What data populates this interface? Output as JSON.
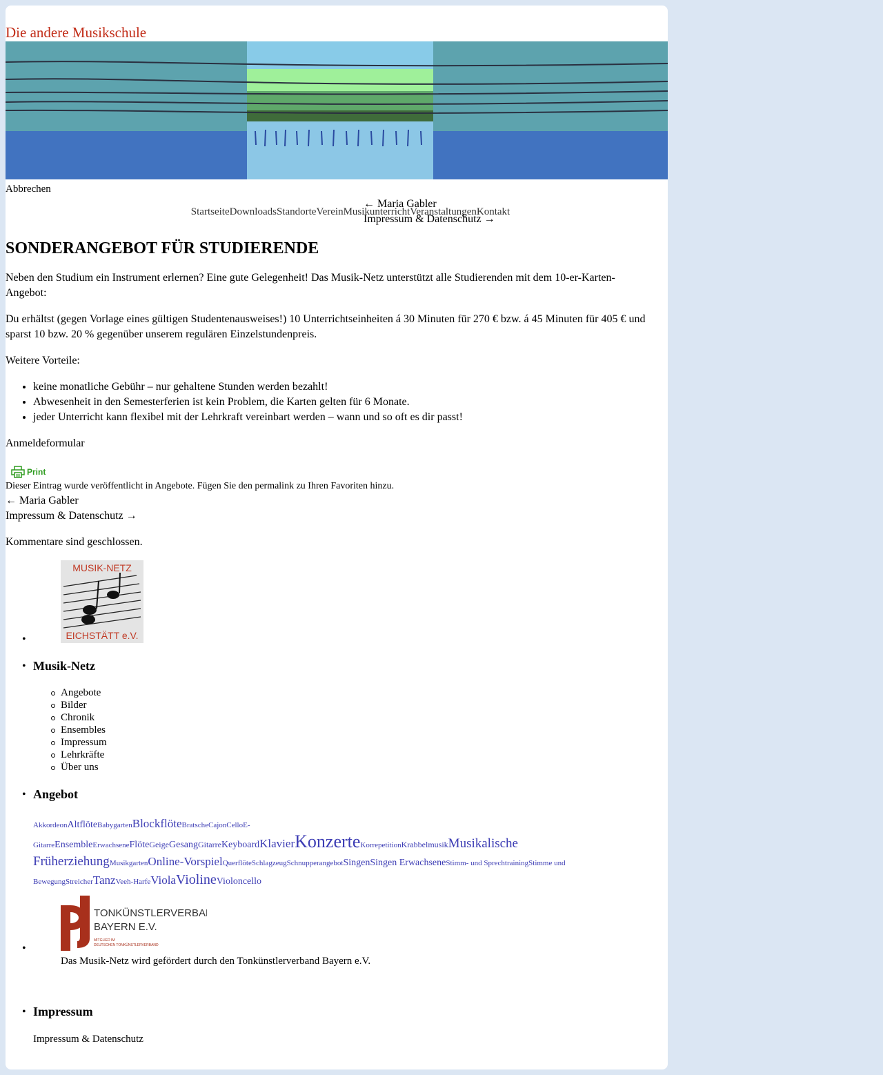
{
  "site": {
    "title": "Die andere Musikschule"
  },
  "abort_label": "Abbrechen",
  "post_nav": {
    "prev": "← Maria Gabler",
    "next": "Impressum & Datenschutz →"
  },
  "menu": [
    "Startseite",
    "Downloads",
    "Standorte",
    "Verein",
    "Musikunterricht",
    "Veranstaltungen",
    "Kontakt"
  ],
  "post": {
    "title": "SONDERANGEBOT FÜR STUDIERENDE",
    "p1": "Neben den Studium ein Instrument erlernen? Eine gute Gelegenheit! Das Musik-Netz unterstützt alle Studierenden mit dem 10-er-Karten-Angebot:",
    "p2": "Du erhältst (gegen Vorlage eines gültigen Studentenausweises!) 10 Unterrichtseinheiten á 30 Minuten für 270 € bzw. á 45 Minuten für 405 € und sparst 10 bzw. 20 % gegenüber unserem regulären Einzelstundenpreis.",
    "p3": "Weitere Vorteile:",
    "advantages": [
      "keine monatliche Gebühr – nur gehaltene Stunden werden bezahlt!",
      "Abwesenheit in den Semesterferien ist kein Problem, die Karten gelten für 6 Monate.",
      "jeder Unterricht kann flexibel mit der Lehrkraft vereinbart werden – wann und so oft es dir passt!"
    ],
    "form_link": "Anmeldeformular",
    "print_label": "Print",
    "meta": "Dieser Eintrag wurde veröffentlicht in Angebote. Fügen Sie den permalink zu Ihren Favoriten hinzu.",
    "comments_closed": "Kommentare sind geschlossen."
  },
  "sidebar": {
    "logo_musiknetz": {
      "line1": "MUSIK-NETZ",
      "line2": "EICHSTÄTT e.V."
    },
    "musiknetz_title": "Musik-Netz",
    "musiknetz_items": [
      "Angebote",
      "Bilder",
      "Chronik",
      "Ensembles",
      "Impressum",
      "Lehrkräfte",
      "Über uns"
    ],
    "angebot_title": "Angebot",
    "tags": [
      {
        "t": "Akkordeon",
        "s": 11
      },
      {
        "t": "Altflöte",
        "s": 14
      },
      {
        "t": "Babygarten",
        "s": 11
      },
      {
        "t": "Blockflöte",
        "s": 17
      },
      {
        "t": "Bratsche",
        "s": 11
      },
      {
        "t": "Cajon",
        "s": 11
      },
      {
        "t": "Cello",
        "s": 11
      },
      {
        "t": "E-Gitarre",
        "s": 11
      },
      {
        "t": "Ensemble",
        "s": 14
      },
      {
        "t": "Erwachsene",
        "s": 11
      },
      {
        "t": "Flöte",
        "s": 14
      },
      {
        "t": "Geige",
        "s": 12
      },
      {
        "t": "Gesang",
        "s": 14
      },
      {
        "t": "Gitarre",
        "s": 12
      },
      {
        "t": "Keyboard",
        "s": 14
      },
      {
        "t": "Klavier",
        "s": 17
      },
      {
        "t": "Konzerte",
        "s": 26
      },
      {
        "t": "Korrepetition",
        "s": 11
      },
      {
        "t": "Krabbelmusik",
        "s": 12
      },
      {
        "t": "Musikalische Früherziehung",
        "s": 19
      },
      {
        "t": "Musikgarten",
        "s": 11
      },
      {
        "t": "Online-Vorspiel",
        "s": 17
      },
      {
        "t": "Querflöte",
        "s": 11
      },
      {
        "t": "Schlagzeug",
        "s": 11
      },
      {
        "t": "Schnupperangebot",
        "s": 11
      },
      {
        "t": "Singen",
        "s": 14
      },
      {
        "t": "Singen Erwachsene",
        "s": 14
      },
      {
        "t": "Stimm- und Sprechtraining",
        "s": 11
      },
      {
        "t": "Stimme und Bewegung",
        "s": 11
      },
      {
        "t": "Streicher",
        "s": 11
      },
      {
        "t": "Tanz",
        "s": 17
      },
      {
        "t": "Veeh-Harfe",
        "s": 11
      },
      {
        "t": "Viola",
        "s": 17
      },
      {
        "t": "Violine",
        "s": 20
      },
      {
        "t": "Violoncello",
        "s": 14
      }
    ],
    "tkv_logo": {
      "line1": "TONKÜNSTLERVERBAND",
      "line2": "BAYERN E.V.",
      "line3": "MITGLIED IM",
      "line4": "DEUTSCHEN TONKÜNSTLERVERBAND"
    },
    "tkv_text": "Das Musik-Netz wird gefördert durch den Tonkünstlerverband Bayern e.V.",
    "impressum_title": "Impressum",
    "impressum_link": "Impressum & Datenschutz"
  },
  "colors": {
    "background": "#dbe6f3",
    "title": "#c22d18",
    "tag": "#3c3cb4",
    "print": "#2e9b1f"
  }
}
